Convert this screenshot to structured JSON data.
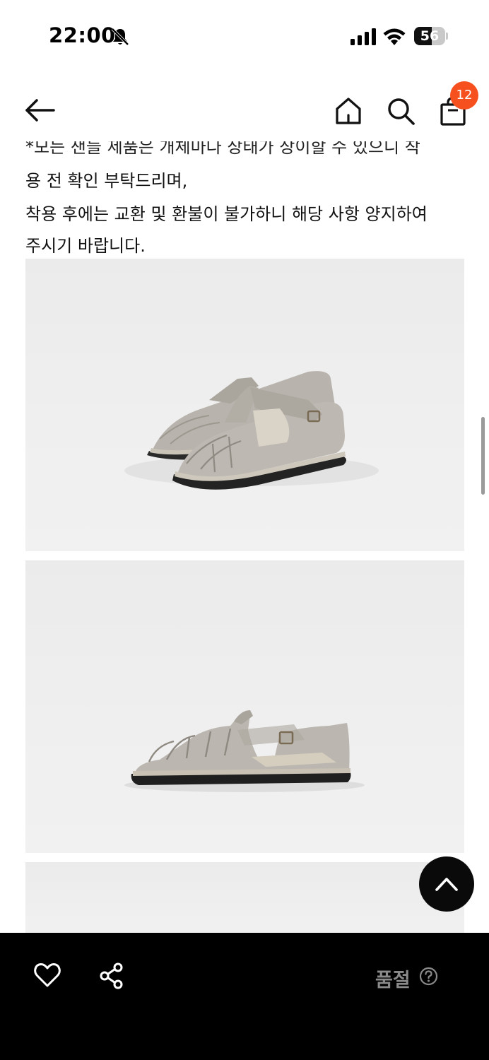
{
  "status_bar": {
    "time": "22:00",
    "battery_level": "56",
    "battery_fraction": 0.56,
    "icons": [
      "bell-off-icon",
      "signal-icon",
      "wifi-icon",
      "battery-icon"
    ]
  },
  "nav": {
    "icons": [
      "back-arrow-icon",
      "home-icon",
      "search-icon",
      "shopping-bag-icon"
    ],
    "cart_count": "12",
    "badge_color": "#f5501e"
  },
  "description": {
    "cut_line": "*모든 샌들 제품은 개체마다 상태가 상이할 수 있으니 착",
    "lines": [
      "용 전 확인 부탁드리며,",
      "착용 후에는 교환 및 환불이 불가하니 해당 사항 양지하여",
      "주시기 바랍니다."
    ]
  },
  "product_images": [
    {
      "kind": "photo",
      "subject": "grey suede fisherman sandals pair"
    },
    {
      "kind": "photo",
      "subject": "grey suede fisherman sandal side view"
    },
    {
      "kind": "photo",
      "subject": "product photo (partially visible)"
    }
  ],
  "floating": {
    "icon": "chevron-up-icon"
  },
  "bottom_bar": {
    "icons": [
      "heart-icon",
      "share-icon",
      "question-circle-icon"
    ],
    "status_label": "품절",
    "background": "#000000",
    "label_color": "#8a8a8a"
  }
}
